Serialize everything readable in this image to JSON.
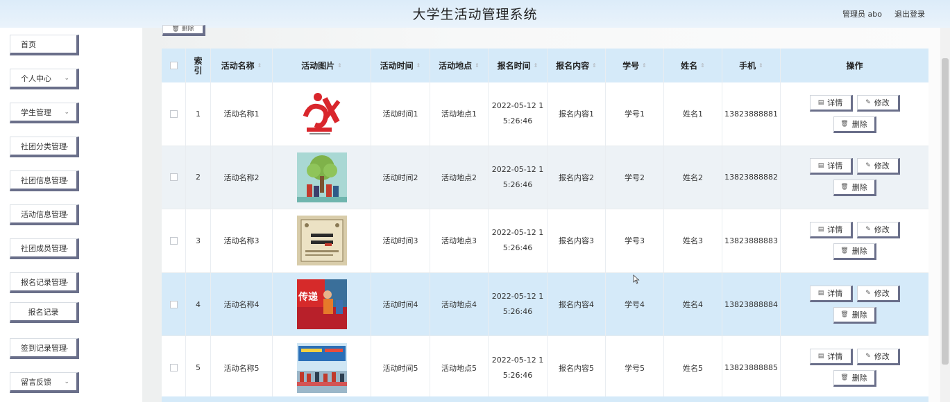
{
  "header": {
    "title": "大学生活动管理系统",
    "admin": "管理员 abo",
    "logout": "退出登录"
  },
  "sidebar": {
    "items": [
      {
        "label": "首页",
        "expandable": false
      },
      {
        "label": "个人中心",
        "expandable": true
      },
      {
        "label": "学生管理",
        "expandable": true
      },
      {
        "label": "社团分类管理",
        "expandable": true
      },
      {
        "label": "社团信息管理",
        "expandable": true
      },
      {
        "label": "活动信息管理",
        "expandable": true
      },
      {
        "label": "社团成员管理",
        "expandable": true
      },
      {
        "label": "报名记录管理",
        "expandable": true
      },
      {
        "label": "报名记录",
        "expandable": false,
        "sub": true
      },
      {
        "label": "签到记录管理",
        "expandable": true
      },
      {
        "label": "留言反馈",
        "expandable": true
      }
    ]
  },
  "toolbar": {
    "delete_label": "删除"
  },
  "table": {
    "columns": [
      "索引",
      "活动名称",
      "活动图片",
      "活动时间",
      "活动地点",
      "报名时间",
      "报名内容",
      "学号",
      "姓名",
      "手机",
      "操作"
    ],
    "rows": [
      {
        "index": "1",
        "name": "活动名称1",
        "image": "yiwu-logo",
        "time": "活动时间1",
        "place": "活动地点1",
        "signup_date": "2022-05-12 1",
        "signup_time": "5:26:46",
        "content": "报名内容1",
        "student_id": "学号1",
        "student_name": "姓名1",
        "phone": "13823888881"
      },
      {
        "index": "2",
        "name": "活动名称2",
        "image": "tree-poster",
        "time": "活动时间2",
        "place": "活动地点2",
        "signup_date": "2022-05-12 1",
        "signup_time": "5:26:46",
        "content": "报名内容2",
        "student_id": "学号2",
        "student_name": "姓名2",
        "phone": "13823888882"
      },
      {
        "index": "3",
        "name": "活动名称3",
        "image": "book-poster",
        "time": "活动时间3",
        "place": "活动地点3",
        "signup_date": "2022-05-12 1",
        "signup_time": "5:26:46",
        "content": "报名内容3",
        "student_id": "学号3",
        "student_name": "姓名3",
        "phone": "13823888883"
      },
      {
        "index": "4",
        "name": "活动名称4",
        "image": "volunteer-photo",
        "time": "活动时间4",
        "place": "活动地点4",
        "signup_date": "2022-05-12 1",
        "signup_time": "5:26:46",
        "content": "报名内容4",
        "student_id": "学号4",
        "student_name": "姓名4",
        "phone": "13823888884"
      },
      {
        "index": "5",
        "name": "活动名称5",
        "image": "event-banner-photo",
        "time": "活动时间5",
        "place": "活动地点5",
        "signup_date": "2022-05-12 1",
        "signup_time": "5:26:46",
        "content": "报名内容5",
        "student_id": "学号5",
        "student_name": "姓名5",
        "phone": "13823888885"
      }
    ],
    "actions": {
      "detail": "详情",
      "edit": "修改",
      "delete": "删除"
    }
  },
  "colors": {
    "header_bg": "#dcecf9",
    "table_header": "#d5eaf9",
    "button_shadow": "#6a6f8a",
    "logo_red": "#d9262c"
  }
}
